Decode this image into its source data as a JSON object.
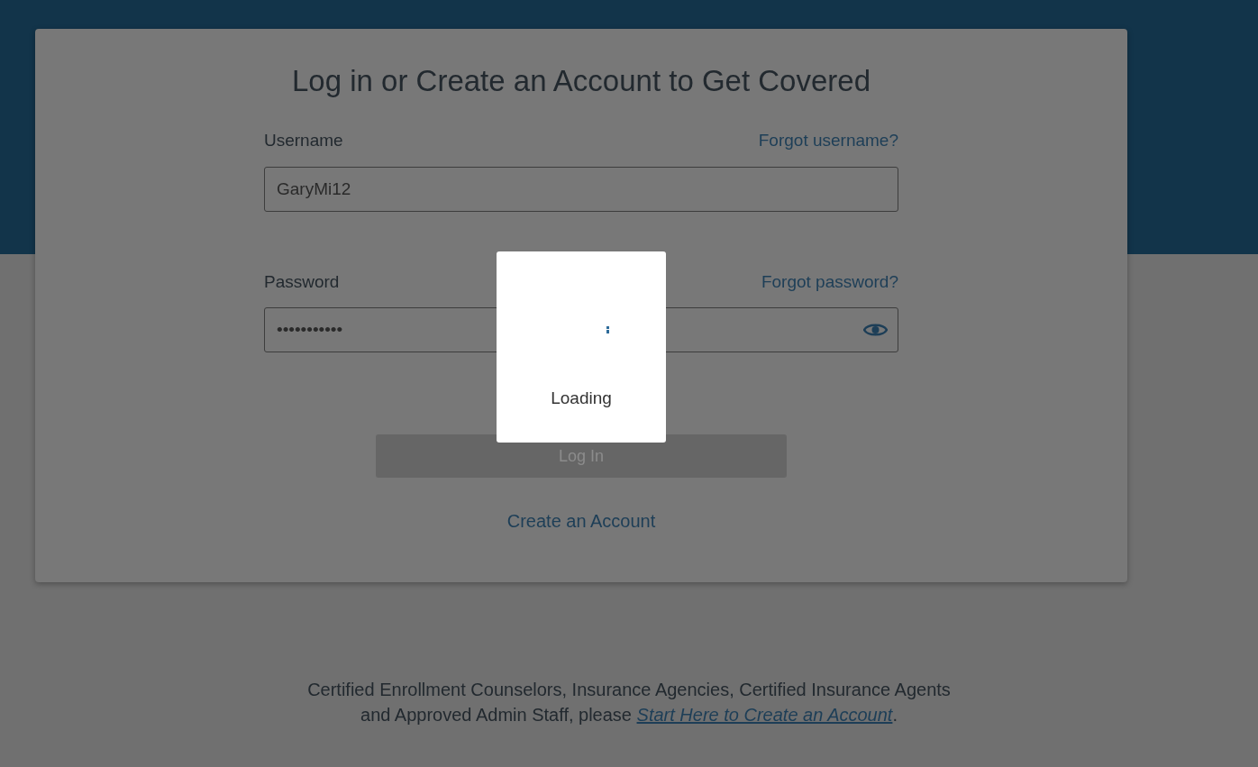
{
  "title": "Log in or Create an Account to Get Covered",
  "username": {
    "label": "Username",
    "link": "Forgot username?",
    "value": "GaryMi12"
  },
  "password": {
    "label": "Password",
    "link": "Forgot password?",
    "value": "•••••••••••"
  },
  "login_button": {
    "label": "Log In",
    "disabled": true
  },
  "create_link": "Create an Account",
  "loading": {
    "text": "Loading"
  },
  "footer": {
    "text": "Certified Enrollment Counselors, Insurance Agencies, Certified Insurance Agents and Approved Admin Staff, please ",
    "link": "Start Here to Create an Account",
    "after": "."
  }
}
